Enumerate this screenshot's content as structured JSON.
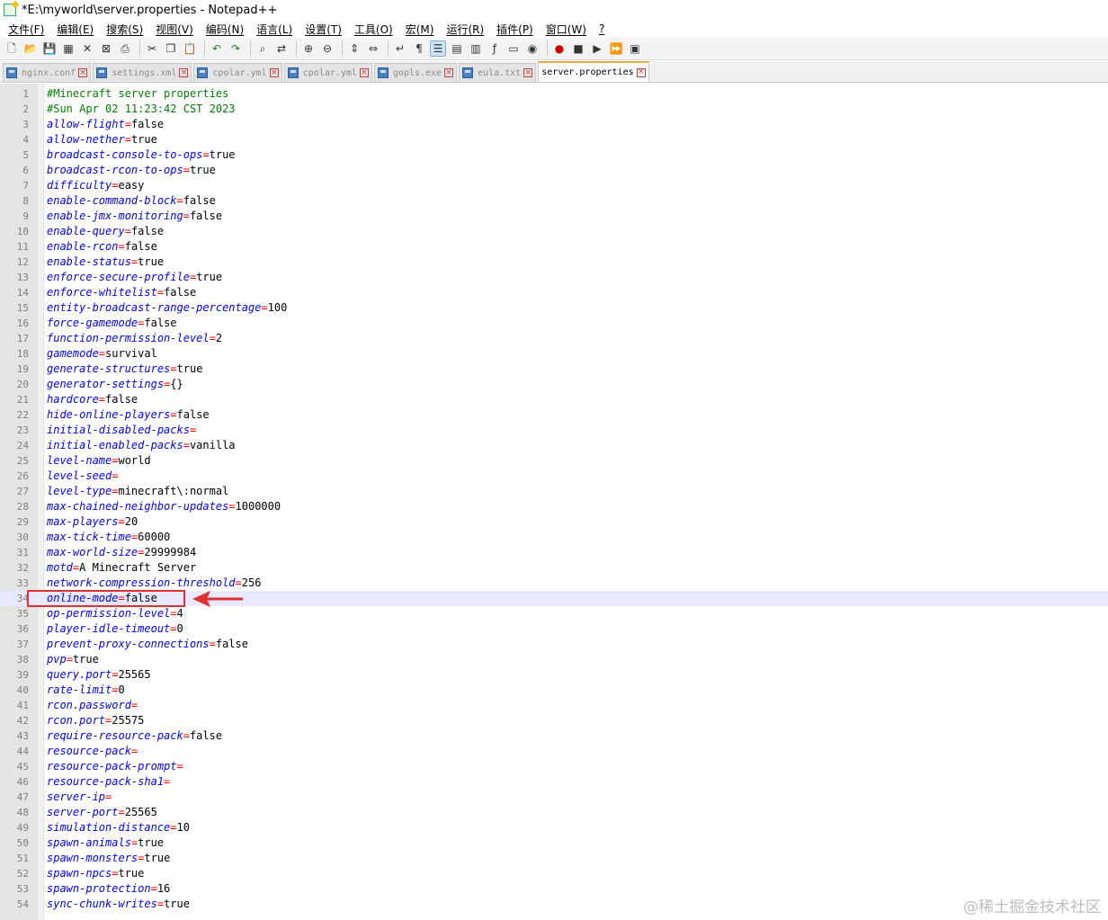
{
  "window": {
    "title": "*E:\\myworld\\server.properties - Notepad++"
  },
  "menu": [
    "文件(F)",
    "编辑(E)",
    "搜索(S)",
    "视图(V)",
    "编码(N)",
    "语言(L)",
    "设置(T)",
    "工具(O)",
    "宏(M)",
    "运行(R)",
    "插件(P)",
    "窗口(W)",
    "?"
  ],
  "toolbar_icons": [
    "new-file-icon",
    "open-file-icon",
    "save-icon",
    "save-all-icon",
    "close-icon",
    "close-all-icon",
    "print-icon",
    "|",
    "cut-icon",
    "copy-icon",
    "paste-icon",
    "|",
    "undo-icon",
    "redo-icon",
    "|",
    "find-icon",
    "replace-icon",
    "|",
    "zoom-in-icon",
    "zoom-out-icon",
    "|",
    "sync-vertical-icon",
    "sync-horizontal-icon",
    "|",
    "word-wrap-icon",
    "show-all-chars-icon",
    "indent-guide-icon",
    "udl-icon",
    "doc-map-icon",
    "function-list-icon",
    "folder-workspace-icon",
    "monitor-icon",
    "|",
    "record-macro-icon",
    "stop-macro-icon",
    "play-macro-icon",
    "run-macro-multiple-icon",
    "save-macro-icon"
  ],
  "tabs": [
    {
      "label": "nginx.conf",
      "active": false
    },
    {
      "label": "settings.xml",
      "active": false
    },
    {
      "label": "cpolar.yml",
      "active": false
    },
    {
      "label": "cpolar.yml",
      "active": false
    },
    {
      "label": "gopls.exe",
      "active": false
    },
    {
      "label": "eula.txt",
      "active": false
    },
    {
      "label": "server.properties",
      "active": true
    }
  ],
  "current_line": 34,
  "lines": [
    {
      "n": 1,
      "comment": "#Minecraft server properties"
    },
    {
      "n": 2,
      "comment": "#Sun Apr 02 11:23:42 CST 2023"
    },
    {
      "n": 3,
      "key": "allow-flight",
      "value": "false"
    },
    {
      "n": 4,
      "key": "allow-nether",
      "value": "true"
    },
    {
      "n": 5,
      "key": "broadcast-console-to-ops",
      "value": "true"
    },
    {
      "n": 6,
      "key": "broadcast-rcon-to-ops",
      "value": "true"
    },
    {
      "n": 7,
      "key": "difficulty",
      "value": "easy"
    },
    {
      "n": 8,
      "key": "enable-command-block",
      "value": "false"
    },
    {
      "n": 9,
      "key": "enable-jmx-monitoring",
      "value": "false"
    },
    {
      "n": 10,
      "key": "enable-query",
      "value": "false"
    },
    {
      "n": 11,
      "key": "enable-rcon",
      "value": "false"
    },
    {
      "n": 12,
      "key": "enable-status",
      "value": "true"
    },
    {
      "n": 13,
      "key": "enforce-secure-profile",
      "value": "true"
    },
    {
      "n": 14,
      "key": "enforce-whitelist",
      "value": "false"
    },
    {
      "n": 15,
      "key": "entity-broadcast-range-percentage",
      "value": "100"
    },
    {
      "n": 16,
      "key": "force-gamemode",
      "value": "false"
    },
    {
      "n": 17,
      "key": "function-permission-level",
      "value": "2"
    },
    {
      "n": 18,
      "key": "gamemode",
      "value": "survival"
    },
    {
      "n": 19,
      "key": "generate-structures",
      "value": "true"
    },
    {
      "n": 20,
      "key": "generator-settings",
      "value": "{}"
    },
    {
      "n": 21,
      "key": "hardcore",
      "value": "false"
    },
    {
      "n": 22,
      "key": "hide-online-players",
      "value": "false"
    },
    {
      "n": 23,
      "key": "initial-disabled-packs",
      "value": ""
    },
    {
      "n": 24,
      "key": "initial-enabled-packs",
      "value": "vanilla"
    },
    {
      "n": 25,
      "key": "level-name",
      "value": "world"
    },
    {
      "n": 26,
      "key": "level-seed",
      "value": ""
    },
    {
      "n": 27,
      "key": "level-type",
      "value": "minecraft\\:normal"
    },
    {
      "n": 28,
      "key": "max-chained-neighbor-updates",
      "value": "1000000"
    },
    {
      "n": 29,
      "key": "max-players",
      "value": "20"
    },
    {
      "n": 30,
      "key": "max-tick-time",
      "value": "60000"
    },
    {
      "n": 31,
      "key": "max-world-size",
      "value": "29999984"
    },
    {
      "n": 32,
      "key": "motd",
      "value": "A Minecraft Server"
    },
    {
      "n": 33,
      "key": "network-compression-threshold",
      "value": "256"
    },
    {
      "n": 34,
      "key": "online-mode",
      "value": "false"
    },
    {
      "n": 35,
      "key": "op-permission-level",
      "value": "4"
    },
    {
      "n": 36,
      "key": "player-idle-timeout",
      "value": "0"
    },
    {
      "n": 37,
      "key": "prevent-proxy-connections",
      "value": "false"
    },
    {
      "n": 38,
      "key": "pvp",
      "value": "true"
    },
    {
      "n": 39,
      "key": "query.port",
      "value": "25565"
    },
    {
      "n": 40,
      "key": "rate-limit",
      "value": "0"
    },
    {
      "n": 41,
      "key": "rcon.password",
      "value": ""
    },
    {
      "n": 42,
      "key": "rcon.port",
      "value": "25575"
    },
    {
      "n": 43,
      "key": "require-resource-pack",
      "value": "false"
    },
    {
      "n": 44,
      "key": "resource-pack",
      "value": ""
    },
    {
      "n": 45,
      "key": "resource-pack-prompt",
      "value": ""
    },
    {
      "n": 46,
      "key": "resource-pack-sha1",
      "value": ""
    },
    {
      "n": 47,
      "key": "server-ip",
      "value": ""
    },
    {
      "n": 48,
      "key": "server-port",
      "value": "25565"
    },
    {
      "n": 49,
      "key": "simulation-distance",
      "value": "10"
    },
    {
      "n": 50,
      "key": "spawn-animals",
      "value": "true"
    },
    {
      "n": 51,
      "key": "spawn-monsters",
      "value": "true"
    },
    {
      "n": 52,
      "key": "spawn-npcs",
      "value": "true"
    },
    {
      "n": 53,
      "key": "spawn-protection",
      "value": "16"
    },
    {
      "n": 54,
      "key": "sync-chunk-writes",
      "value": "true"
    }
  ],
  "watermark": "@稀土掘金技术社区",
  "colors": {
    "key": "#0000ff",
    "operator": "#ff0000",
    "comment": "#008000",
    "annotation": "#e03030",
    "current_line": "#e8e8ff",
    "active_tab_accent": "#f5a742"
  }
}
